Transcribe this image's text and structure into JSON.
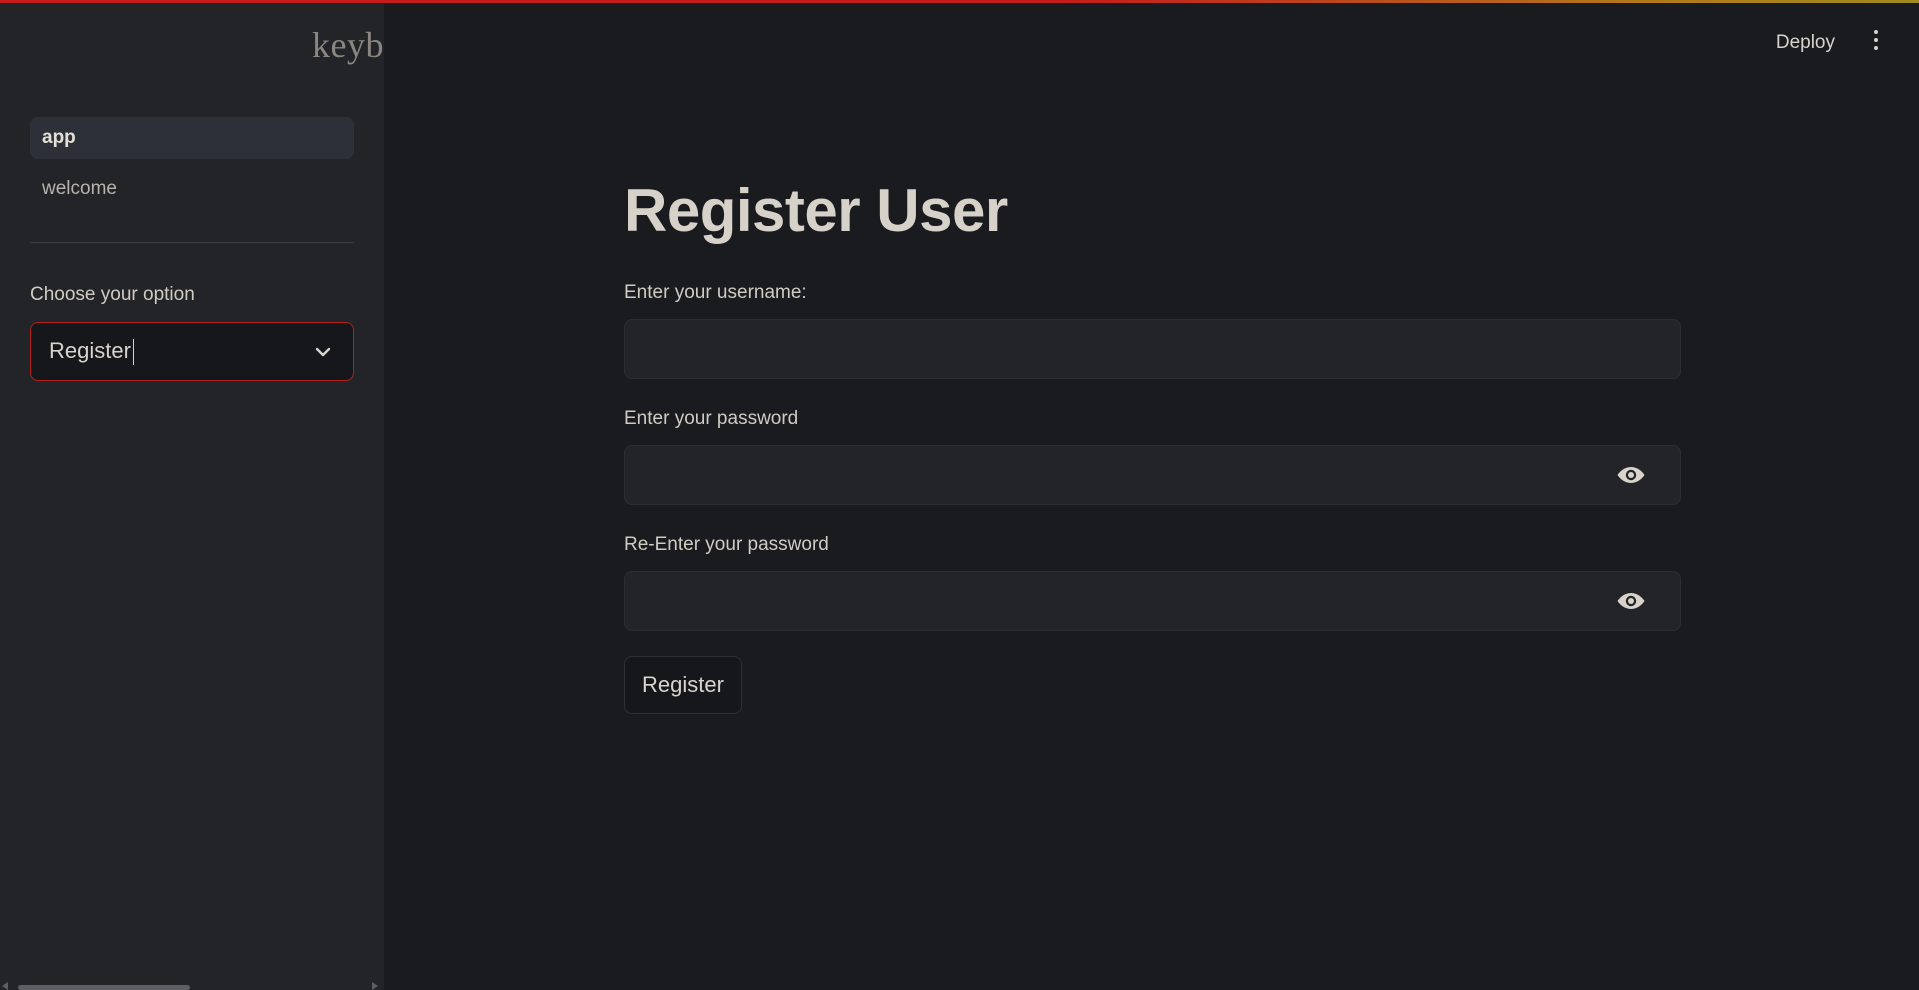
{
  "colors": {
    "background": "#1a1b1e",
    "sidebar": "#232428",
    "accent_red": "#b3201f",
    "text": "#d0cbc3"
  },
  "sidebar": {
    "logo_text": "keyb",
    "nav": [
      {
        "label": "app",
        "active": true
      },
      {
        "label": "welcome",
        "active": false
      }
    ],
    "option_label": "Choose your option",
    "select": {
      "value": "Register",
      "icon": "chevron-down-icon"
    }
  },
  "header": {
    "deploy_label": "Deploy",
    "menu_icon": "kebab-menu-icon"
  },
  "form": {
    "title": "Register User",
    "fields": [
      {
        "label": "Enter your username:",
        "value": "",
        "type": "text"
      },
      {
        "label": "Enter your password",
        "value": "",
        "type": "password",
        "icon": "eye-icon"
      },
      {
        "label": "Re-Enter your password",
        "value": "",
        "type": "password",
        "icon": "eye-icon"
      }
    ],
    "submit_label": "Register"
  }
}
